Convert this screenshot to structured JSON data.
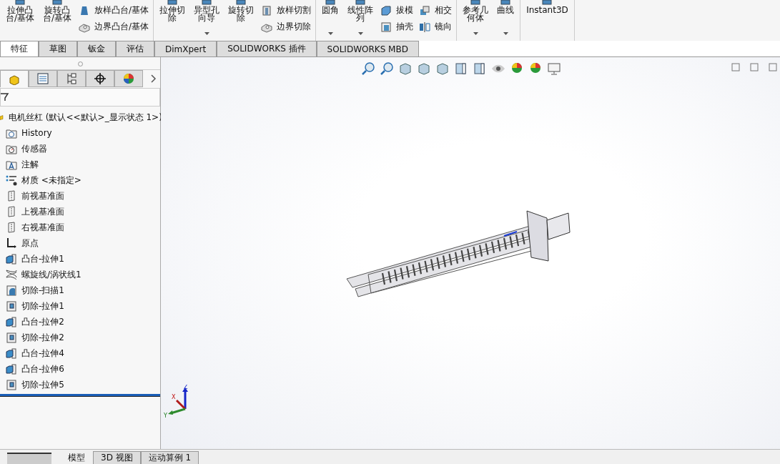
{
  "ribbon": {
    "groups": [
      {
        "items": [
          {
            "kind": "large",
            "lines": [
              "拉伸凸",
              "台/基体"
            ],
            "dropdown": false
          },
          {
            "kind": "large",
            "lines": [
              "旋转凸",
              "台/基体"
            ],
            "dropdown": false
          },
          {
            "kind": "stack",
            "items": [
              {
                "label": "放样凸台/基体",
                "kind": "loft"
              },
              {
                "label": "边界凸台/基体",
                "kind": "boundary"
              }
            ]
          }
        ]
      },
      {
        "items": [
          {
            "kind": "large",
            "lines": [
              "拉伸切",
              "除"
            ],
            "dropdown": false
          },
          {
            "kind": "large",
            "lines": [
              "异型孔",
              "向导"
            ],
            "dropdown": true
          },
          {
            "kind": "large",
            "lines": [
              "旋转切",
              "除"
            ],
            "dropdown": false
          },
          {
            "kind": "stack",
            "items": [
              {
                "label": "放样切割",
                "kind": "loft-cut"
              },
              {
                "label": "边界切除",
                "kind": "boundary"
              }
            ]
          }
        ]
      },
      {
        "items": [
          {
            "kind": "large",
            "lines": [
              "圆角"
            ],
            "dropdown": true
          },
          {
            "kind": "large",
            "lines": [
              "线性阵",
              "列"
            ],
            "dropdown": true
          },
          {
            "kind": "stack",
            "items": [
              {
                "label": "拔模",
                "kind": "draft"
              },
              {
                "label": "抽壳",
                "kind": "shell"
              }
            ]
          },
          {
            "kind": "stack",
            "items": [
              {
                "label": "相交",
                "kind": "intersect"
              },
              {
                "label": "镜向",
                "kind": "mirror"
              }
            ]
          }
        ]
      },
      {
        "items": [
          {
            "kind": "large",
            "lines": [
              "参考几",
              "何体"
            ],
            "dropdown": true
          },
          {
            "kind": "large",
            "lines": [
              "曲线"
            ],
            "dropdown": true
          }
        ]
      },
      {
        "items": [
          {
            "kind": "large",
            "lines": [
              "Instant3D"
            ],
            "dropdown": false
          }
        ]
      }
    ]
  },
  "command_tabs": [
    {
      "label": "特征",
      "selected": true
    },
    {
      "label": "草图",
      "selected": false
    },
    {
      "label": "钣金",
      "selected": false
    },
    {
      "label": "评估",
      "selected": false
    },
    {
      "label": "DimXpert",
      "selected": false
    },
    {
      "label": "SOLIDWORKS 插件",
      "selected": false
    },
    {
      "label": "SOLIDWORKS MBD",
      "selected": false
    }
  ],
  "manager_tabs": [
    {
      "kind": "feature",
      "selected": true
    },
    {
      "kind": "property",
      "selected": false
    },
    {
      "kind": "config",
      "selected": false
    },
    {
      "kind": "dimxpert",
      "selected": false
    },
    {
      "kind": "display",
      "selected": false
    }
  ],
  "tree": {
    "root": "电机丝杠  (默认<<默认>_显示状态 1>)",
    "children": [
      {
        "label": "History",
        "kind": "history"
      },
      {
        "label": "传感器",
        "kind": "sensor"
      },
      {
        "label": "注解",
        "kind": "annotation"
      },
      {
        "label": "材质 <未指定>",
        "kind": "material"
      },
      {
        "label": "前视基准面",
        "kind": "plane"
      },
      {
        "label": "上视基准面",
        "kind": "plane"
      },
      {
        "label": "右视基准面",
        "kind": "plane"
      },
      {
        "label": "原点",
        "kind": "origin"
      },
      {
        "label": "凸台-拉伸1",
        "kind": "boss"
      },
      {
        "label": "螺旋线/涡状线1",
        "kind": "helix"
      },
      {
        "label": "切除-扫描1",
        "kind": "sweep"
      },
      {
        "label": "切除-拉伸1",
        "kind": "cut"
      },
      {
        "label": "凸台-拉伸2",
        "kind": "boss"
      },
      {
        "label": "切除-拉伸2",
        "kind": "cut"
      },
      {
        "label": "凸台-拉伸4",
        "kind": "boss"
      },
      {
        "label": "凸台-拉伸6",
        "kind": "boss"
      },
      {
        "label": "切除-拉伸5",
        "kind": "cut"
      }
    ]
  },
  "triad": {
    "x": "X",
    "y": "Y",
    "z": "Z"
  },
  "bottom_tabs": [
    {
      "label": "模型",
      "selected": true
    },
    {
      "label": "3D 视图",
      "selected": false
    },
    {
      "label": "运动算例 1",
      "selected": false
    }
  ]
}
